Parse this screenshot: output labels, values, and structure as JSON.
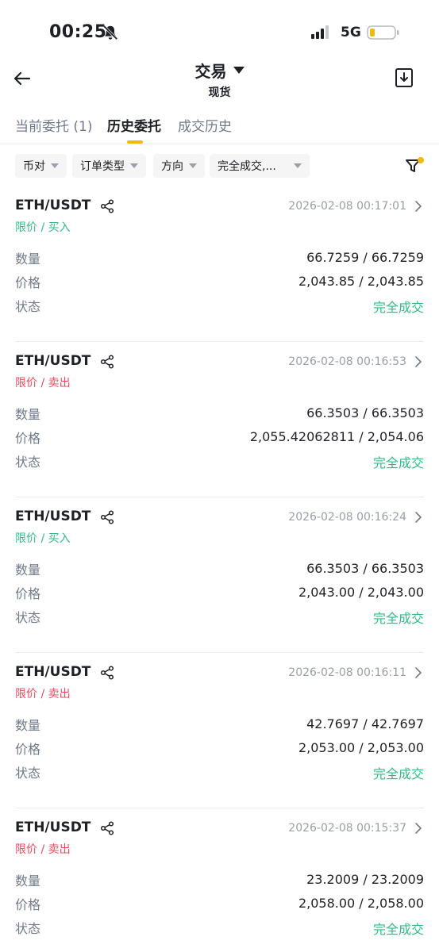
{
  "status_bar": {
    "time": "00:25",
    "network": "5G"
  },
  "header": {
    "title": "交易",
    "subtitle": "现货"
  },
  "tabs": [
    {
      "label": "当前委托 (1)",
      "active": false
    },
    {
      "label": "历史委托",
      "active": true
    },
    {
      "label": "成交历史",
      "active": false
    }
  ],
  "filters": [
    {
      "label": "币对"
    },
    {
      "label": "订单类型"
    },
    {
      "label": "方向"
    },
    {
      "label": "完全成交,..."
    }
  ],
  "labels": {
    "quantity": "数量",
    "price": "价格",
    "status": "状态"
  },
  "colors": {
    "accent": "#f0b90b",
    "buy": "#2ebd85",
    "sell": "#f6465d"
  },
  "orders": [
    {
      "pair": "ETH/USDT",
      "type": "限价 / 买入",
      "side": "buy",
      "time": "2026-02-08 00:17:01",
      "quantity": "66.7259 / 66.7259",
      "price": "2,043.85 / 2,043.85",
      "status": "完全成交"
    },
    {
      "pair": "ETH/USDT",
      "type": "限价 / 卖出",
      "side": "sell",
      "time": "2026-02-08 00:16:53",
      "quantity": "66.3503 / 66.3503",
      "price": "2,055.42062811 / 2,054.06",
      "status": "完全成交"
    },
    {
      "pair": "ETH/USDT",
      "type": "限价 / 买入",
      "side": "buy",
      "time": "2026-02-08 00:16:24",
      "quantity": "66.3503 / 66.3503",
      "price": "2,043.00 / 2,043.00",
      "status": "完全成交"
    },
    {
      "pair": "ETH/USDT",
      "type": "限价 / 卖出",
      "side": "sell",
      "time": "2026-02-08 00:16:11",
      "quantity": "42.7697 / 42.7697",
      "price": "2,053.00 / 2,053.00",
      "status": "完全成交"
    },
    {
      "pair": "ETH/USDT",
      "type": "限价 / 卖出",
      "side": "sell",
      "time": "2026-02-08 00:15:37",
      "quantity": "23.2009 / 23.2009",
      "price": "2,058.00 / 2,058.00",
      "status": "完全成交"
    }
  ]
}
